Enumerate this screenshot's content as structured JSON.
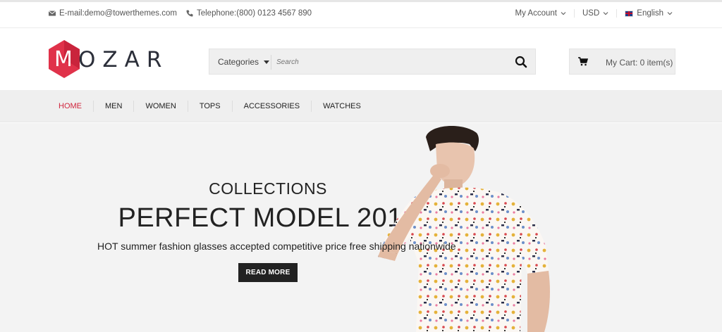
{
  "topbar": {
    "email": "E-mail:demo@towerthemes.com",
    "phone": "Telephone:(800) 0123 4567 890",
    "account_label": "My Account",
    "currency_label": "USD",
    "language_label": "English"
  },
  "header": {
    "logo_text": "MOZAR",
    "categories_label": "Categories",
    "search_placeholder": "Search",
    "cart_label": "My Cart: 0 item(s)"
  },
  "nav": {
    "items": [
      {
        "label": "HOME",
        "active": true
      },
      {
        "label": "MEN"
      },
      {
        "label": "WOMEN"
      },
      {
        "label": "TOPS"
      },
      {
        "label": "ACCESSORIES"
      },
      {
        "label": "WATCHES"
      }
    ]
  },
  "hero": {
    "subtitle": "COLLECTIONS",
    "title": "PERFECT MODEL 2015",
    "description": "HOT summer fashion glasses accepted competitive price free shipping nationwide",
    "button_label": "READ MORE"
  },
  "colors": {
    "accent": "#d0263d",
    "logo_hex": "#e0324a",
    "dark": "#222222"
  }
}
